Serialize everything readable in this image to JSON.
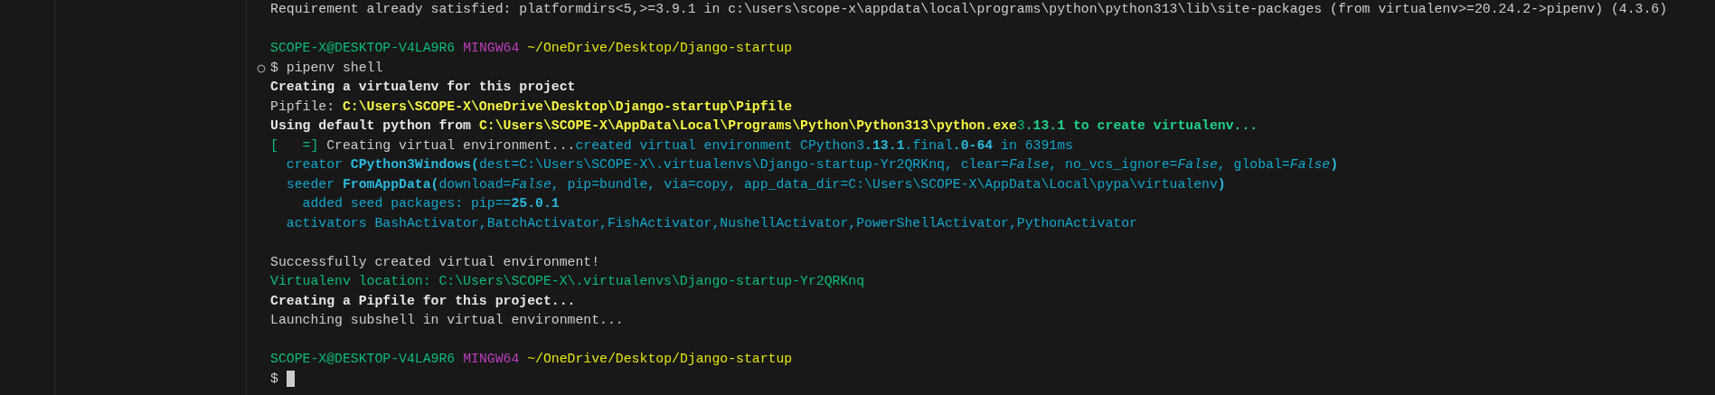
{
  "terminal": {
    "lines": [
      {
        "kind": "output",
        "segments": [
          {
            "kind": "plain",
            "text": "Requirement already satisfied: platformdirs<5,>=3.9.1 in c:\\users\\scope-x\\appdata\\local\\programs\\python\\python313\\lib\\site-packages (from virtualenv>=20.24.2->pipenv) (4.3.6)"
          }
        ]
      },
      {
        "kind": "blank"
      },
      {
        "kind": "prompt",
        "user": "SCOPE-X@DESKTOP-V4LA9R6",
        "shell": "MINGW64",
        "path": "~/OneDrive/Desktop/Django-startup"
      },
      {
        "kind": "command",
        "marker": true,
        "text": "$ pipenv shell"
      },
      {
        "kind": "output",
        "segments": [
          {
            "kind": "bold",
            "text": "Creating a virtualenv for this project"
          }
        ]
      },
      {
        "kind": "output",
        "segments": [
          {
            "kind": "plain",
            "text": "Pipfile: "
          },
          {
            "kind": "yellow-bold",
            "text": "C:\\Users\\SCOPE-X\\OneDrive\\Desktop\\Django-startup\\Pipfile"
          }
        ]
      },
      {
        "kind": "output",
        "segments": [
          {
            "kind": "bold",
            "text": "Using default python from "
          },
          {
            "kind": "yellow-bold",
            "text": "C:\\Users\\SCOPE-X\\AppData\\Local\\Programs\\Python\\Python313\\python.exe"
          },
          {
            "kind": "green",
            "text": "3"
          },
          {
            "kind": "green-bold",
            "text": ".13.1 to create virtualenv..."
          }
        ]
      },
      {
        "kind": "output",
        "segments": [
          {
            "kind": "green",
            "text": "[   =]"
          },
          {
            "kind": "plain",
            "text": " Creating virtual environment..."
          },
          {
            "kind": "cyan",
            "text": "created virtual environment CPython3"
          },
          {
            "kind": "cyan-bold",
            "text": ".13.1"
          },
          {
            "kind": "cyan",
            "text": ".final"
          },
          {
            "kind": "cyan-bold",
            "text": ".0-64"
          },
          {
            "kind": "cyan",
            "text": " in 6391ms"
          }
        ]
      },
      {
        "kind": "output",
        "segments": [
          {
            "kind": "cyan",
            "text": "  creator "
          },
          {
            "kind": "cyan-bold",
            "text": "CPython3Windows("
          },
          {
            "kind": "cyan",
            "text": "dest=C:\\Users\\SCOPE-X\\.virtualenvs\\Django-startup-Yr2QRKnq, clear="
          },
          {
            "kind": "cyan-italic",
            "text": "False"
          },
          {
            "kind": "cyan",
            "text": ", no_vcs_ignore="
          },
          {
            "kind": "cyan-italic",
            "text": "False"
          },
          {
            "kind": "cyan",
            "text": ", global="
          },
          {
            "kind": "cyan-italic",
            "text": "False"
          },
          {
            "kind": "cyan-bold",
            "text": ")"
          }
        ]
      },
      {
        "kind": "output",
        "segments": [
          {
            "kind": "cyan",
            "text": "  seeder "
          },
          {
            "kind": "cyan-bold",
            "text": "FromAppData("
          },
          {
            "kind": "cyan",
            "text": "download="
          },
          {
            "kind": "cyan-italic",
            "text": "False"
          },
          {
            "kind": "cyan",
            "text": ", pip=bundle, via=copy, app_data_dir=C:\\Users\\SCOPE-X\\AppData\\Local\\pypa\\virtualenv"
          },
          {
            "kind": "cyan-bold",
            "text": ")"
          }
        ]
      },
      {
        "kind": "output",
        "segments": [
          {
            "kind": "cyan",
            "text": "    added seed packages: pip=="
          },
          {
            "kind": "cyan-bold",
            "text": "25.0.1"
          }
        ]
      },
      {
        "kind": "output",
        "segments": [
          {
            "kind": "cyan",
            "text": "  activators BashActivator,BatchActivator,FishActivator,NushellActivator,PowerShellActivator,PythonActivator"
          }
        ]
      },
      {
        "kind": "blank"
      },
      {
        "kind": "output",
        "segments": [
          {
            "kind": "plain",
            "text": "Successfully created virtual environment!"
          }
        ]
      },
      {
        "kind": "output",
        "segments": [
          {
            "kind": "green",
            "text": "Virtualenv location: C:\\Users\\SCOPE-X\\.virtualenvs\\Django-startup-Yr2QRKnq"
          }
        ]
      },
      {
        "kind": "output",
        "segments": [
          {
            "kind": "bold",
            "text": "Creating a Pipfile for this project..."
          }
        ]
      },
      {
        "kind": "output",
        "segments": [
          {
            "kind": "plain",
            "text": "Launching subshell in virtual environment..."
          }
        ]
      },
      {
        "kind": "blank"
      },
      {
        "kind": "prompt",
        "user": "SCOPE-X@DESKTOP-V4LA9R6",
        "shell": "MINGW64",
        "path": "~/OneDrive/Desktop/Django-startup"
      },
      {
        "kind": "input",
        "cursor": true,
        "text": "$"
      }
    ]
  }
}
